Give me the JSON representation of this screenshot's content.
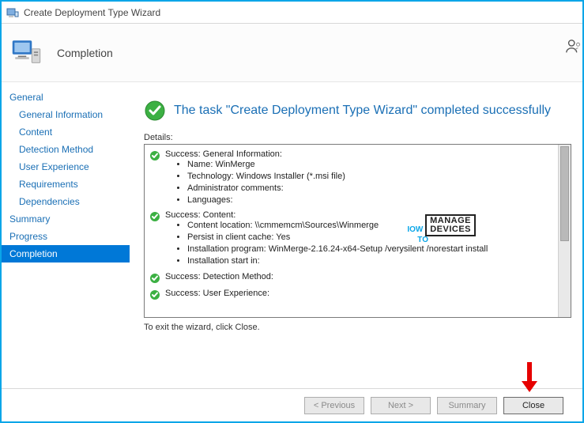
{
  "window": {
    "title": "Create Deployment Type Wizard"
  },
  "header": {
    "stage": "Completion"
  },
  "sidebar": {
    "items": [
      {
        "label": "General",
        "indent": false,
        "selected": false
      },
      {
        "label": "General Information",
        "indent": true,
        "selected": false
      },
      {
        "label": "Content",
        "indent": true,
        "selected": false
      },
      {
        "label": "Detection Method",
        "indent": true,
        "selected": false
      },
      {
        "label": "User Experience",
        "indent": true,
        "selected": false
      },
      {
        "label": "Requirements",
        "indent": true,
        "selected": false
      },
      {
        "label": "Dependencies",
        "indent": true,
        "selected": false
      },
      {
        "label": "Summary",
        "indent": false,
        "selected": false
      },
      {
        "label": "Progress",
        "indent": false,
        "selected": false
      },
      {
        "label": "Completion",
        "indent": false,
        "selected": true
      }
    ]
  },
  "main": {
    "headline": "The task \"Create Deployment Type Wizard\" completed successfully",
    "details_label": "Details:",
    "sections": [
      {
        "title": "Success: General Information:",
        "bullets": [
          "Name: WinMerge",
          "Technology: Windows Installer (*.msi file)",
          "Administrator comments:",
          "Languages:"
        ]
      },
      {
        "title": "Success: Content:",
        "bullets": [
          "Content location: \\\\cmmemcm\\Sources\\Winmerge",
          "Persist in client cache: Yes",
          "Installation program: WinMerge-2.16.24-x64-Setup /verysilent /norestart install",
          "Installation start in:"
        ]
      },
      {
        "title": "Success: Detection Method:",
        "bullets": []
      },
      {
        "title": "Success: User Experience:",
        "bullets": []
      }
    ],
    "exit_text": "To exit the wizard, click Close."
  },
  "watermark": {
    "line1": "IOW",
    "line2": "TO",
    "box1": "MANAGE",
    "box2": "DEVICES"
  },
  "footer": {
    "previous": "< Previous",
    "next": "Next >",
    "summary": "Summary",
    "close": "Close"
  }
}
